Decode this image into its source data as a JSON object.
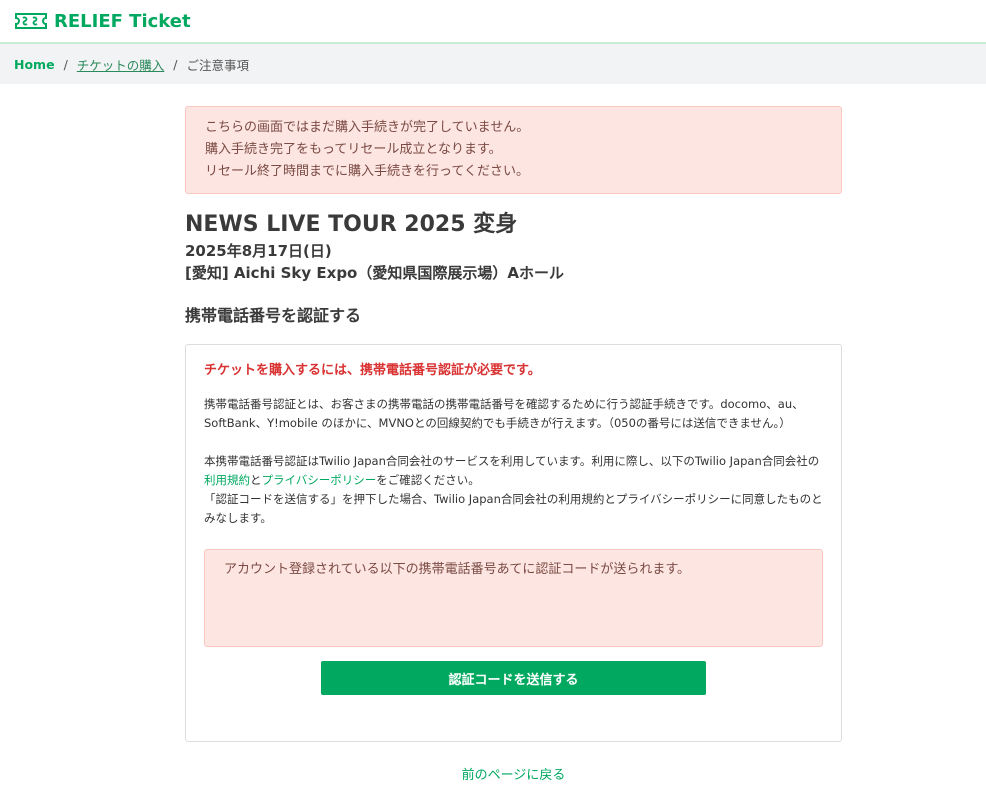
{
  "header": {
    "logo_text": "RELIEF Ticket",
    "logo_icon": "ticket-logo-icon",
    "brand_color": "#00a95f"
  },
  "breadcrumb": {
    "home": "Home",
    "purchase": "チケットの購入",
    "current": "ご注意事項",
    "separator": "/"
  },
  "alert": {
    "lines": [
      "こちらの画面ではまだ購入手続きが完了していません。",
      "購入手続き完了をもってリセール成立となります。",
      "リセール終了時間までに購入手続きを行ってください。"
    ]
  },
  "event": {
    "title": "NEWS LIVE TOUR 2025 変身",
    "date": "2025年8月17日(日)",
    "venue": "[愛知] Aichi Sky Expo（愛知県国際展示場）Aホール"
  },
  "verification": {
    "section_title": "携帯電話番号を認証する",
    "warning": "チケットを購入するには、携帯電話番号認証が必要です。",
    "paragraph1": "携帯電話番号認証とは、お客さまの携帯電話の携帯電話番号を確認するために行う認証手続きです。docomo、au、SoftBank、Y!mobile のほかに、MVNOとの回線契約でも手続きが行えます。（050の番号には送信できません。）",
    "paragraph2_prefix": "本携帯電話番号認証はTwilio Japan合同会社のサービスを利用しています。利用に際し、以下のTwilio Japan合同会社の",
    "terms_link": "利用規約",
    "and": "と",
    "privacy_link": "プライバシーポリシー",
    "paragraph2_suffix": "をご確認ください。",
    "paragraph3": "「認証コードを送信する」を押下した場合、Twilio Japan合同会社の利用規約とプライバシーポリシーに同意したものとみなします。",
    "phone_notice": "アカウント登録されている以下の携帯電話番号あてに認証コードが送られます。",
    "send_button": "認証コードを送信する"
  },
  "back_link": "前のページに戻る",
  "colors": {
    "accent": "#00a95f",
    "alert_bg": "#fde5e1",
    "warning_text": "#d93232"
  }
}
